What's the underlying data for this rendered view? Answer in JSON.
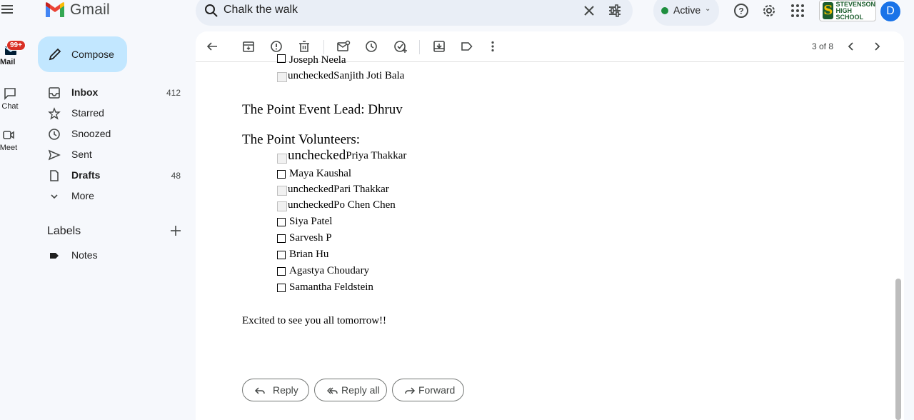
{
  "app": {
    "name": "Gmail"
  },
  "search": {
    "query": "Chalk the walk"
  },
  "status": {
    "label": "Active",
    "color": "#1e8e3e"
  },
  "account": {
    "school_line1": "STEVENSON",
    "school_line2": "HIGH SCHOOL",
    "avatar_letter": "D"
  },
  "rail": {
    "mail_label": "Mail",
    "mail_badge": "99+",
    "chat_label": "Chat",
    "meet_label": "Meet"
  },
  "nav": {
    "compose_label": "Compose",
    "items": [
      {
        "label": "Inbox",
        "count": "412"
      },
      {
        "label": "Starred",
        "count": ""
      },
      {
        "label": "Snoozed",
        "count": ""
      },
      {
        "label": "Sent",
        "count": ""
      },
      {
        "label": "Drafts",
        "count": "48"
      },
      {
        "label": "More",
        "count": ""
      }
    ],
    "labels_title": "Labels",
    "labels": [
      {
        "label": "Notes"
      }
    ]
  },
  "toolbar": {
    "pager": "3 of 8"
  },
  "email": {
    "cut_line": "Joseph Neela",
    "top_items": [
      {
        "alt": "unchecked",
        "name": "Sanjith Joti Bala"
      }
    ],
    "lead_line": "The Point Event Lead: Dhruv",
    "volunteers_heading": "The Point Volunteers:",
    "volunteers": [
      {
        "kind": "broken-large",
        "alt": "unchecked",
        "name": "Priya Thakkar"
      },
      {
        "kind": "box",
        "alt": "",
        "name": "Maya Kaushal"
      },
      {
        "kind": "broken",
        "alt": "unchecked",
        "name": "Pari Thakkar"
      },
      {
        "kind": "broken",
        "alt": "unchecked",
        "name": "Po Chen Chen"
      },
      {
        "kind": "box",
        "alt": "",
        "name": "Siya Patel"
      },
      {
        "kind": "box",
        "alt": "",
        "name": "Sarvesh P"
      },
      {
        "kind": "box",
        "alt": "",
        "name": "Brian Hu"
      },
      {
        "kind": "box",
        "alt": "",
        "name": "Agastya Choudary"
      },
      {
        "kind": "box",
        "alt": "",
        "name": "Samantha Feldstein"
      }
    ],
    "closing": "Excited to see you all tomorrow!!"
  },
  "actions": {
    "reply": "Reply",
    "reply_all": "Reply all",
    "forward": "Forward"
  }
}
